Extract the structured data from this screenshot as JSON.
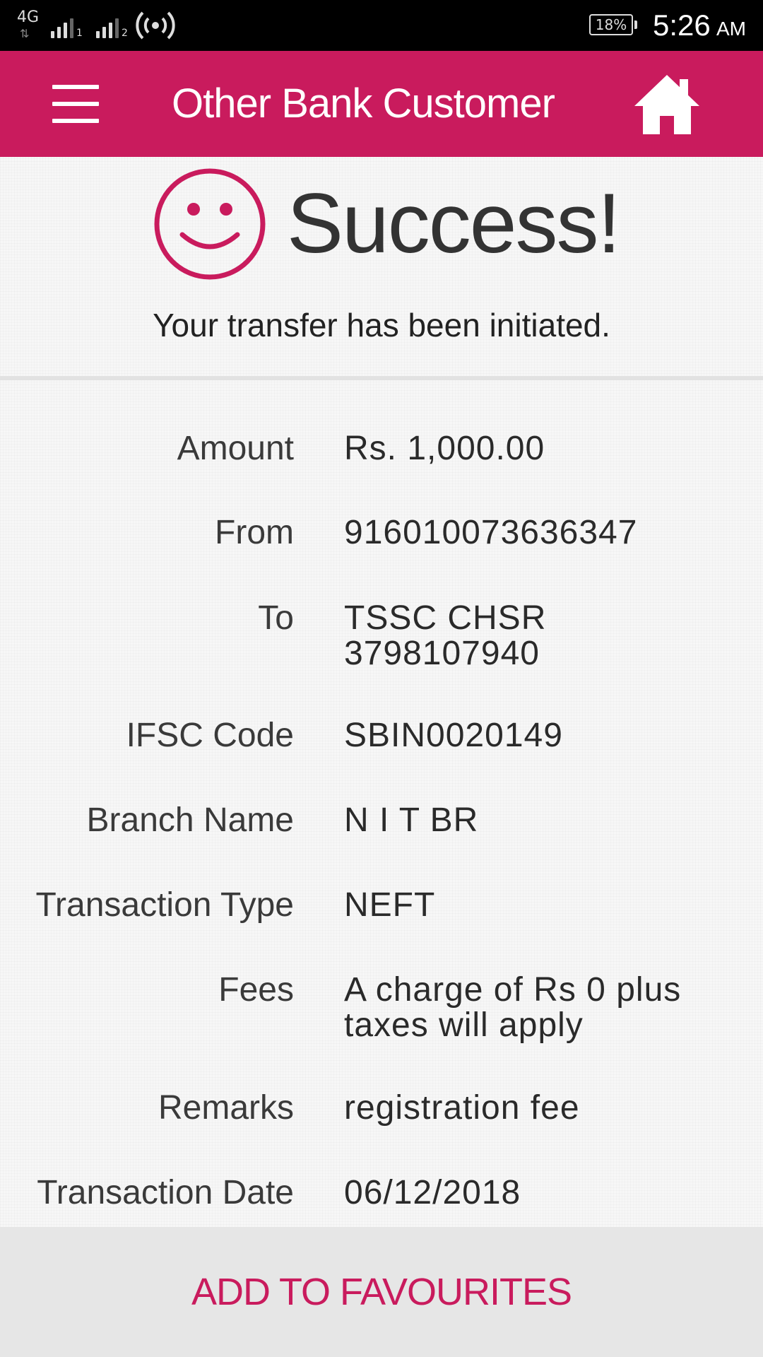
{
  "status_bar": {
    "network_type": "4G",
    "sim1_label": "1",
    "sim2_label": "2",
    "battery_percent": "18%",
    "time": "5:26",
    "ampm": "AM"
  },
  "header": {
    "title": "Other Bank Customer",
    "menu_icon": "hamburger-menu-icon",
    "home_icon": "home-icon",
    "background_color": "#c91b5d"
  },
  "success": {
    "title": "Success!",
    "subtitle": "Your transfer has been initiated.",
    "icon": "smiley-icon"
  },
  "details": [
    {
      "label": "Amount",
      "value": "Rs. 1,000.00"
    },
    {
      "label": "From",
      "value": "916010073636347"
    },
    {
      "label": "To",
      "value_line1": "TSSC CHSR",
      "value_line2": "3798107940"
    },
    {
      "label": "IFSC Code",
      "value": "SBIN0020149"
    },
    {
      "label": "Branch Name",
      "value": "N I T BR"
    },
    {
      "label": "Transaction Type",
      "value": "NEFT"
    },
    {
      "label": "Fees",
      "value_line1": "A charge of Rs 0 plus",
      "value_line2": "taxes will apply"
    },
    {
      "label": "Remarks",
      "value": "registration fee"
    },
    {
      "label": "Transaction Date",
      "value": "06/12/2018"
    }
  ],
  "footer": {
    "add_to_favourites_label": "ADD TO FAVOURITES",
    "accent_color": "#c91b5d"
  }
}
